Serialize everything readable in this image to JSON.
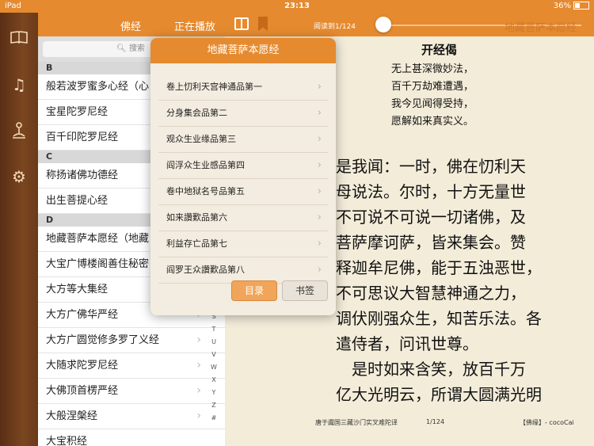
{
  "status": {
    "device": "iPad",
    "time": "23:13",
    "battery": "36%"
  },
  "nav": {
    "tab1": "佛经",
    "tab2": "正在播放",
    "progress": "阅读到1/124",
    "progress_fraction": 0.0,
    "header_title": "地藏菩萨本愿经"
  },
  "search": {
    "placeholder": "搜索"
  },
  "sections": [
    {
      "letter": "B",
      "items": [
        "般若波罗蜜多心经（心",
        "宝星陀罗尼经",
        "百千印陀罗尼经"
      ]
    },
    {
      "letter": "C",
      "items": [
        "称扬诸佛功德经",
        "出生菩提心经"
      ]
    },
    {
      "letter": "D",
      "items": [
        "地藏菩萨本愿经（地藏",
        "大宝广博楼阁善住秘密",
        "大方等大集经",
        "大方广佛华严经",
        "大方广圆觉修多罗了义经",
        "大随求陀罗尼经",
        "大佛顶首楞严经",
        "大般涅槃经",
        "大宝积经"
      ]
    }
  ],
  "index_letters": [
    "S",
    "T",
    "U",
    "V",
    "W",
    "X",
    "Y",
    "Z",
    "#"
  ],
  "popover": {
    "title": "地藏菩萨本愿经",
    "chapters": [
      "卷上忉利天宫神通品第一",
      "分身集会品第二",
      "观众生业缘品第三",
      "阎浮众生业感品第四",
      "卷中地狱名号品第五",
      "如来讚歎品第六",
      "利益存亡品第七",
      "阎罗王众讚歎品第八"
    ],
    "btn_toc": "目录",
    "btn_bookmark": "书签"
  },
  "page": {
    "verse_title": "开经偈",
    "verse": [
      "无上甚深微妙法，",
      "百千万劫难遭遇，",
      "我今见闻得受持，",
      "愿解如来真实义。"
    ],
    "body": [
      "是我闻：一时，佛在忉利天",
      "母说法。尔时，十方无量世",
      "不可说不可说一切诸佛，及",
      "菩萨摩诃萨，皆来集会。赞",
      "释迦牟尼佛，能于五浊恶世，",
      "不可思议大智慧神通之力，",
      "调伏刚强众生，知苦乐法。各",
      "遣侍者，问讯世尊。",
      "　是时如来含笑，放百千万",
      "亿大光明云，所谓大圆满光明"
    ],
    "translator": "唐于阗国三藏沙门实叉难陀译",
    "page_num": "1/124",
    "credit": "【佛缘】- cocoCai"
  }
}
